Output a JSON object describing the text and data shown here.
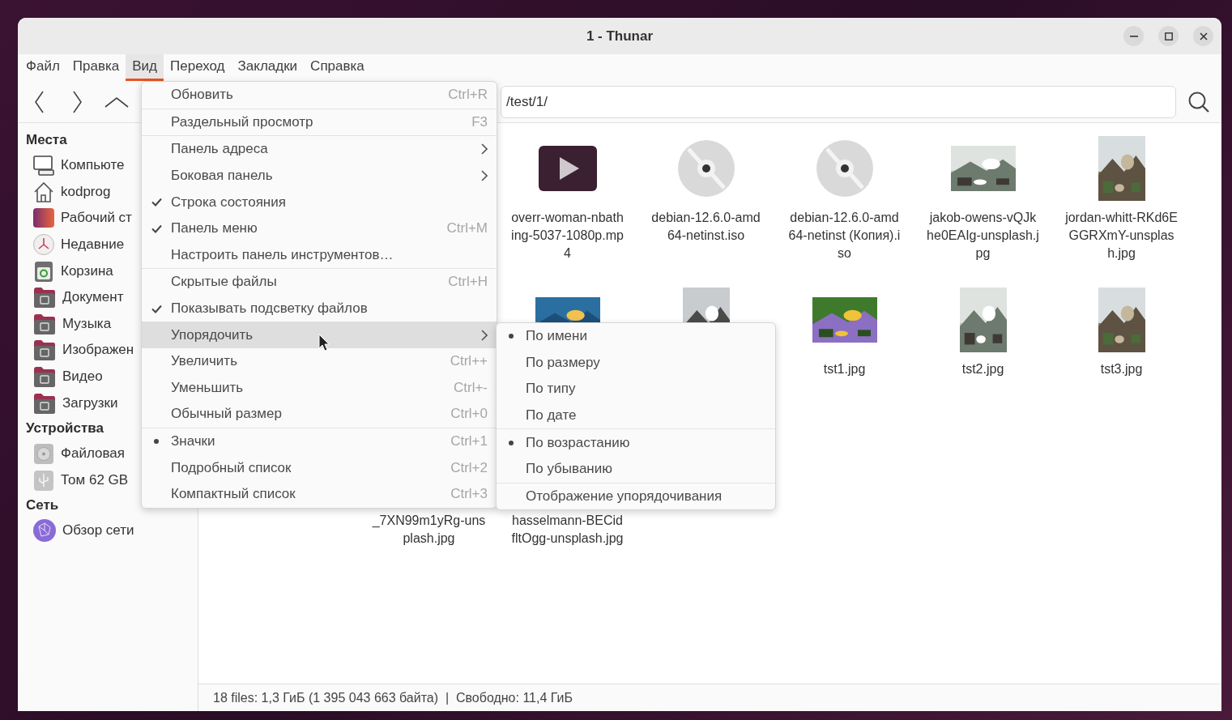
{
  "window": {
    "title": "1 - Thunar"
  },
  "menubar": [
    {
      "label": "Файл",
      "selected": false
    },
    {
      "label": "Правка",
      "selected": false
    },
    {
      "label": "Вид",
      "selected": true
    },
    {
      "label": "Переход",
      "selected": false
    },
    {
      "label": "Закладки",
      "selected": false
    },
    {
      "label": "Справка",
      "selected": false
    }
  ],
  "location": {
    "value": "/test/1/"
  },
  "sidebar": {
    "sections": [
      {
        "title": "Места",
        "items": [
          {
            "label": "Компьюте",
            "kind": "computer"
          },
          {
            "label": "kodprog",
            "kind": "home"
          },
          {
            "label": "Рабочий ст",
            "kind": "desktop"
          },
          {
            "label": "Недавние",
            "kind": "recent"
          },
          {
            "label": "Корзина",
            "kind": "trash"
          },
          {
            "label": "Документ",
            "kind": "folder"
          },
          {
            "label": "Музыка",
            "kind": "folder"
          },
          {
            "label": "Изображен",
            "kind": "folder"
          },
          {
            "label": "Видео",
            "kind": "folder"
          },
          {
            "label": "Загрузки",
            "kind": "folder"
          }
        ]
      },
      {
        "title": "Устройства",
        "items": [
          {
            "label": "Файловая",
            "kind": "drive"
          },
          {
            "label": "Том 62 GB",
            "kind": "usb"
          }
        ]
      },
      {
        "title": "Сеть",
        "items": [
          {
            "label": "Обзор сети",
            "kind": "network"
          }
        ]
      }
    ]
  },
  "files": {
    "rows": [
      [
        {
          "kind": "covered"
        },
        {
          "kind": "covered"
        },
        {
          "kind": "video",
          "label": "overr-woman-nbathing-5037-1080p.mp4"
        },
        {
          "kind": "disc",
          "label": "debian-12.6.0-amd64-netinst.iso"
        },
        {
          "kind": "disc",
          "label": "debian-12.6.0-amd64-netinst (Копия).iso"
        },
        {
          "kind": "landscape",
          "label": "jakob-owens-vQJkhe0EAIg-unsplash.jpg"
        },
        {
          "kind": "portrait",
          "label": "jordan-whitt-RKd6EGGRXmY-unsplash.jpg"
        }
      ],
      [
        {
          "kind": "covered"
        },
        {
          "kind": "covered"
        },
        {
          "kind": "landscape"
        },
        {
          "kind": "portrait"
        },
        {
          "kind": "landscape",
          "label": "tst1.jpg"
        },
        {
          "kind": "portrait",
          "label": "tst2.jpg"
        },
        {
          "kind": "portrait",
          "label": "tst3.jpg"
        }
      ],
      [
        {
          "kind": "covered"
        },
        {
          "kind": "covered",
          "label": "_7XN99m1yRg-unsplash.jpg"
        },
        {
          "kind": "covered",
          "label": "hasselmann-BECidfltOgg-unsplash.jpg"
        }
      ]
    ]
  },
  "view_menu": [
    {
      "kind": "plain",
      "label": "Обновить",
      "shortcut": "Ctrl+R",
      "highlighted": false
    },
    {
      "kind": "separator"
    },
    {
      "kind": "plain",
      "label": "Раздельный просмотр",
      "shortcut": "F3",
      "highlighted": false
    },
    {
      "kind": "separator"
    },
    {
      "kind": "submenu",
      "label": "Панель адреса",
      "highlighted": false
    },
    {
      "kind": "submenu",
      "label": "Боковая панель",
      "highlighted": false
    },
    {
      "kind": "check",
      "label": "Строка состояния",
      "checked": true,
      "highlighted": false
    },
    {
      "kind": "check",
      "label": "Панель меню",
      "shortcut": "Ctrl+M",
      "checked": true,
      "highlighted": false
    },
    {
      "kind": "plain",
      "label": "Настроить панель инструментов…",
      "highlighted": false
    },
    {
      "kind": "separator"
    },
    {
      "kind": "check",
      "label": "Скрытые файлы",
      "shortcut": "Ctrl+H",
      "checked": false,
      "highlighted": false
    },
    {
      "kind": "check",
      "label": "Показывать подсветку файлов",
      "checked": true,
      "highlighted": false
    },
    {
      "kind": "submenu",
      "label": "Упорядочить",
      "highlighted": true
    },
    {
      "kind": "plain",
      "label": "Увеличить",
      "shortcut": "Ctrl++",
      "highlighted": false
    },
    {
      "kind": "plain",
      "label": "Уменьшить",
      "shortcut": "Ctrl+-",
      "highlighted": false
    },
    {
      "kind": "plain",
      "label": "Обычный размер",
      "shortcut": "Ctrl+0",
      "highlighted": false
    },
    {
      "kind": "separator"
    },
    {
      "kind": "radio",
      "label": "Значки",
      "shortcut": "Ctrl+1",
      "selected": true,
      "highlighted": false
    },
    {
      "kind": "radio",
      "label": "Подробный список",
      "shortcut": "Ctrl+2",
      "selected": false,
      "highlighted": false
    },
    {
      "kind": "radio",
      "label": "Компактный список",
      "shortcut": "Ctrl+3",
      "selected": false,
      "highlighted": false
    }
  ],
  "sort_menu": [
    {
      "kind": "radio",
      "label": "По имени",
      "selected": true,
      "highlighted": false
    },
    {
      "kind": "radio",
      "label": "По размеру",
      "selected": false,
      "highlighted": false
    },
    {
      "kind": "radio",
      "label": "По типу",
      "selected": false,
      "highlighted": false
    },
    {
      "kind": "radio",
      "label": "По дате",
      "selected": false,
      "highlighted": false
    },
    {
      "kind": "separator"
    },
    {
      "kind": "radio",
      "label": "По возрастанию",
      "selected": true,
      "highlighted": false
    },
    {
      "kind": "radio",
      "label": "По убыванию",
      "selected": false,
      "highlighted": false
    },
    {
      "kind": "separator"
    },
    {
      "kind": "plain",
      "label": "Отображение упорядочивания",
      "highlighted": false
    }
  ],
  "status_bar": {
    "text": "18 files: 1,3 ГиБ (1 395 043 663 байта)  |  Свободно: 11,4 ГиБ"
  }
}
